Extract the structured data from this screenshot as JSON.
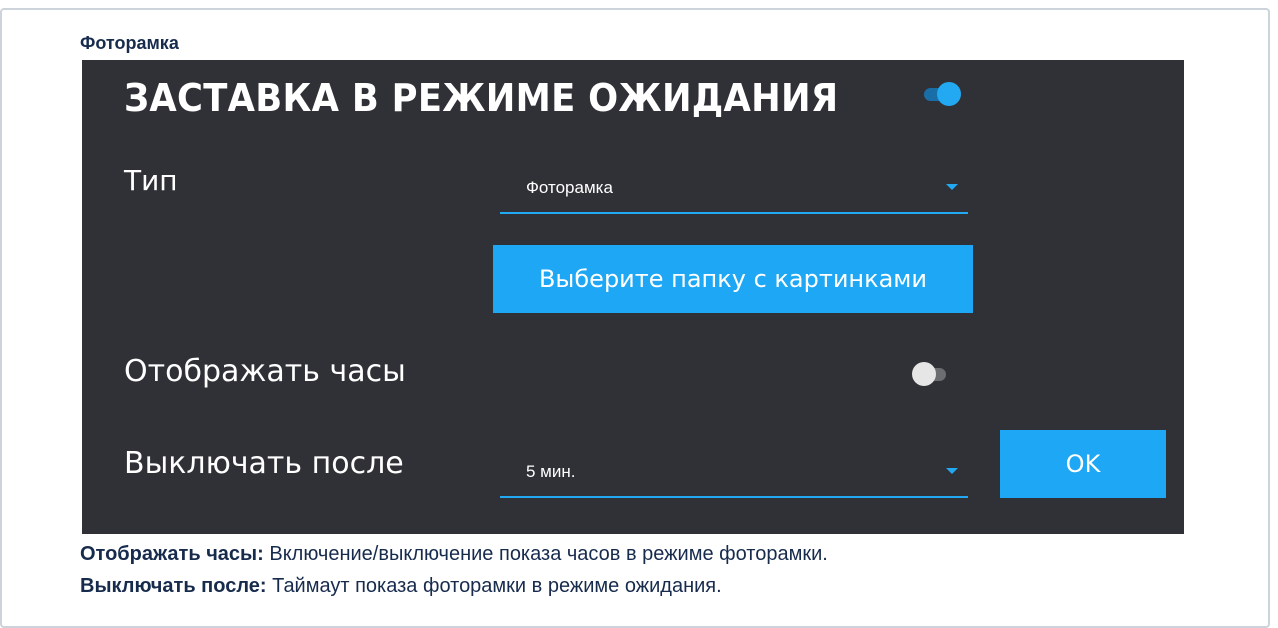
{
  "document": {
    "heading": "Фоторамка"
  },
  "screen": {
    "title": "ЗАСТАВКА В РЕЖИМЕ ОЖИДАНИЯ",
    "screensaver_enabled": true,
    "type_label": "Тип",
    "type_value": "Фоторамка",
    "choose_folder_button": "Выберите папку с картинками",
    "show_clock_label": "Отображать часы",
    "show_clock_enabled": false,
    "turn_off_label": "Выключать после",
    "turn_off_value": "5 мин.",
    "ok_button": "OK"
  },
  "notes": [
    {
      "term": "Отображать часы:",
      "text": " Включение/выключение показа часов в режиме фоторамки."
    },
    {
      "term": "Выключать после:",
      "text": " Таймаут показа фоторамки в режиме ожидания."
    }
  ],
  "colors": {
    "accent": "#23a8f2",
    "panel": "#2f3136"
  }
}
